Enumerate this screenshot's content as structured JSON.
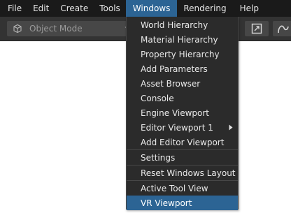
{
  "menubar": {
    "items": [
      {
        "label": "File"
      },
      {
        "label": "Edit"
      },
      {
        "label": "Create"
      },
      {
        "label": "Tools"
      },
      {
        "label": "Windows"
      },
      {
        "label": "Rendering"
      },
      {
        "label": "Help"
      }
    ],
    "open_menu": "Windows"
  },
  "toolbar": {
    "mode_select": {
      "value": "Object Mode",
      "icon": "cube-icon"
    },
    "buttons": [
      {
        "icon": "maximize-icon"
      },
      {
        "icon": "curve-icon"
      }
    ]
  },
  "windows_menu": {
    "items": [
      {
        "label": "World Hierarchy"
      },
      {
        "label": "Material Hierarchy"
      },
      {
        "label": "Property Hierarchy"
      },
      {
        "label": "Add Parameters"
      },
      {
        "label": "Asset Browser"
      },
      {
        "label": "Console"
      },
      {
        "label": "Engine Viewport"
      },
      {
        "label": "Editor Viewport 1",
        "submenu": true
      },
      {
        "label": "Add Editor Viewport"
      },
      {
        "label": "Settings"
      },
      {
        "label": "Reset Windows Layout"
      },
      {
        "label": "Active Tool View"
      },
      {
        "label": "VR Viewport",
        "highlighted": true
      }
    ]
  },
  "colors": {
    "menubar_bg": "#1a1a1a",
    "toolbar_bg": "#333333",
    "menu_bg": "#2b2b2b",
    "highlight": "#2c6494"
  }
}
